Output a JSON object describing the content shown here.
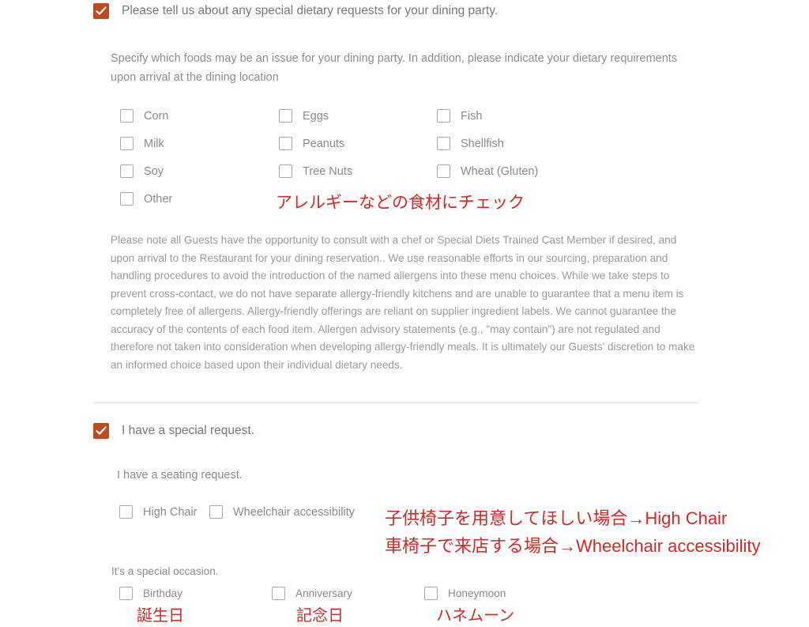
{
  "dietary_section": {
    "header_label": "Please tell us about any special dietary requests for your dining party.",
    "header_checked": true,
    "intro_text": "Specify which foods may be an issue for your dining party. In addition, please indicate your dietary requirements upon arrival at the dining location",
    "allergen_options": [
      {
        "label": "Corn",
        "checked": false
      },
      {
        "label": "Milk",
        "checked": false
      },
      {
        "label": "Soy",
        "checked": false
      },
      {
        "label": "Other",
        "checked": false
      },
      {
        "label": "Eggs",
        "checked": false
      },
      {
        "label": "Peanuts",
        "checked": false
      },
      {
        "label": "Tree Nuts",
        "checked": false
      },
      {
        "label": "Fish",
        "checked": false
      },
      {
        "label": "Shellfish",
        "checked": false
      },
      {
        "label": "Wheat (Gluten)",
        "checked": false
      }
    ],
    "annotation": "アレルギーなどの食材にチェック",
    "disclaimer": "Please note all Guests have the opportunity to consult with a chef or Special Diets Trained Cast Member if desired, and upon arrival to the Restaurant for your dining reservation.. We use reasonable efforts in our sourcing, preparation and handling procedures to avoid the introduction of the named allergens into these menu choices. While we take steps to prevent cross-contact, we do not have separate allergy-friendly kitchens and are unable to guarantee that a menu item is completely free of allergens. Allergy-friendly offerings are reliant on supplier ingredient labels. We cannot guarantee the accuracy of the contents of each food item. Allergen advisory statements (e.g., \"may contain\") are not regulated and therefore not taken into consideration when developing allergy-friendly meals. It is ultimately our Guests' discretion to make an informed choice based upon their individual dietary needs."
  },
  "special_request_section": {
    "header_label": "I have a special request.",
    "header_checked": true,
    "seating_label": "I have a seating request.",
    "seating_options": [
      {
        "label": "High Chair",
        "checked": false
      },
      {
        "label": "Wheelchair accessibility",
        "checked": false
      }
    ],
    "annotations": [
      "子供椅子を用意してほしい場合→High Chair",
      "車椅子で来店する場合→Wheelchair accessibility"
    ],
    "occasion_label": "It's a special occasion.",
    "occasion_options": [
      {
        "label": "Birthday",
        "checked": false,
        "annotation": "誕生日"
      },
      {
        "label": "Anniversary",
        "checked": false,
        "annotation": "記念日"
      },
      {
        "label": "Honeymoon",
        "checked": false,
        "annotation": "ハネムーン"
      }
    ]
  },
  "colors": {
    "checkbox_accent": "#c0491f",
    "annotation_red": "#cf2a2a",
    "body_text": "#8a8a8a",
    "divider": "#e6e6e6"
  }
}
